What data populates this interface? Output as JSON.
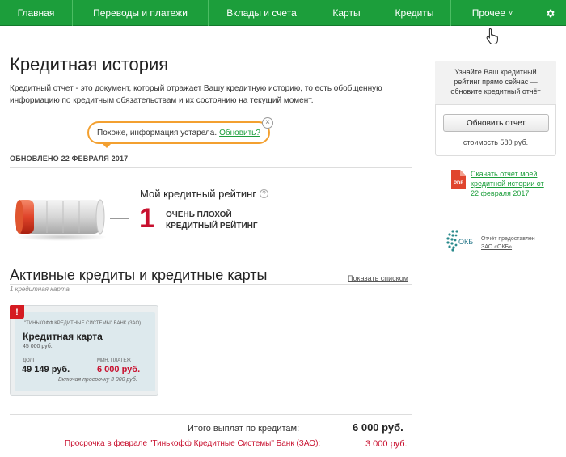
{
  "nav": {
    "items": [
      {
        "label": "Главная"
      },
      {
        "label": "Переводы и платежи"
      },
      {
        "label": "Вклады и счета"
      },
      {
        "label": "Карты"
      },
      {
        "label": "Кредиты"
      },
      {
        "label": "Прочее"
      }
    ],
    "more_chevron": "˅",
    "settings_icon": "gear-icon",
    "accent": "#1c9e3b"
  },
  "page": {
    "title": "Кредитная история",
    "description": "Кредитный отчет - это документ, который отражает Вашу кредитную историю, то есть обобщенную информацию по кредитным обязательствам и их состоянию на текущий момент."
  },
  "notice": {
    "text": "Похоже, информация устарела.",
    "link": "Обновить?",
    "close": "×"
  },
  "updated": "ОБНОВЛЕНО 22 ФЕВРАЛЯ 2017",
  "rating": {
    "label": "Мой кредитный рейтинг",
    "help": "?",
    "value": "1",
    "text_line1": "ОЧЕНЬ ПЛОХОЙ",
    "text_line2": "КРЕДИТНЫЙ РЕЙТИНГ",
    "level": 0.1,
    "color": "#c8102e"
  },
  "loans": {
    "title": "Активные кредиты и кредитные карты",
    "show_list": "Показать списком",
    "count": "1 кредитная карта",
    "card": {
      "badge": "!",
      "bank": "\"Тинькофф Кредитные Системы\" Банк (ЗАО)",
      "name": "Кредитная карта",
      "limit": "45 000 руб.",
      "debt_label": "ДОЛГ",
      "debt": "49 149 руб.",
      "min_label": "МИН. ПЛАТЕЖ",
      "min": "6 000 руб.",
      "overdue": "Включая просрочку 3 000 руб."
    }
  },
  "totals": {
    "total_label": "Итого выплат по кредитам:",
    "total_value": "6 000 руб.",
    "overdue_label": "Просрочка в феврале \"Тинькофф Кредитные Системы\" Банк (ЗАО):",
    "overdue_value": "3 000 руб."
  },
  "side": {
    "message": "Узнайте Ваш кредитный рейтинг прямо сейчас — обновите кредитный отчёт",
    "button": "Обновить отчет",
    "cost": "стоимость 580 руб.",
    "pdf_label": "PDF",
    "pdf_link": "Скачать отчет моей кредитной истории от 22 февраля 2017",
    "okb_logo": "ОКБ",
    "okb_text": "Отчёт предоставлен",
    "okb_link": "ЗАО «ОКБ»"
  }
}
